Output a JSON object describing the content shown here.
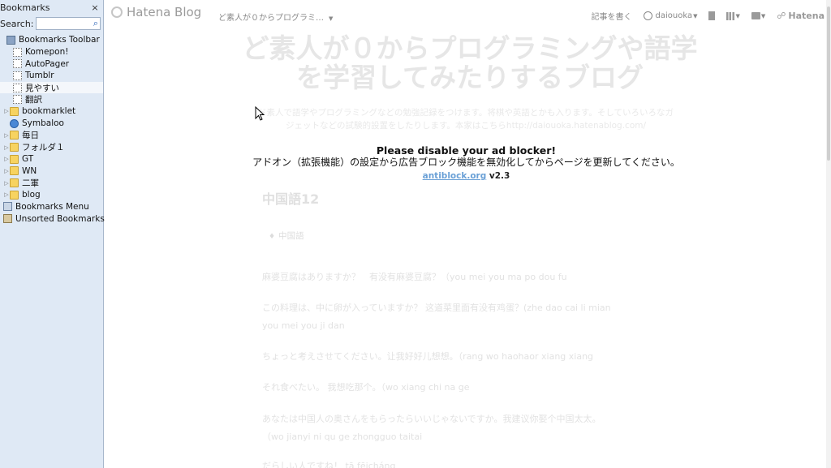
{
  "sidebar": {
    "title": "Bookmarks",
    "close": "×",
    "search_label": "Search:",
    "items": [
      {
        "label": "Bookmarks Toolbar",
        "icon": "toolbar-icon"
      },
      {
        "label": "Komepon!",
        "icon": "page-icon"
      },
      {
        "label": "AutoPager",
        "icon": "page-icon"
      },
      {
        "label": "Tumblr",
        "icon": "page-icon"
      },
      {
        "label": "見やすい",
        "icon": "page-icon"
      },
      {
        "label": "翻訳",
        "icon": "page-icon"
      },
      {
        "label": "bookmarklet",
        "icon": "folder-icon"
      },
      {
        "label": "Symbaloo",
        "icon": "globe-icon"
      },
      {
        "label": "毎日",
        "icon": "folder-icon"
      },
      {
        "label": "フォルダ１",
        "icon": "folder-icon"
      },
      {
        "label": "GT",
        "icon": "folder-icon"
      },
      {
        "label": "WN",
        "icon": "folder-icon"
      },
      {
        "label": "二軍",
        "icon": "folder-icon"
      },
      {
        "label": "blog",
        "icon": "folder-icon"
      },
      {
        "label": "Bookmarks Menu",
        "icon": "menu-icon"
      },
      {
        "label": "Unsorted Bookmarks",
        "icon": "unsorted-icon"
      }
    ]
  },
  "topbar": {
    "logo": "Hatena Blog",
    "breadcrumb": "ど素人が０からプログラミ…",
    "write": "記事を書く",
    "user": "daiouoka",
    "hatena": "Hatena"
  },
  "blog": {
    "title_line1": "ど素人が０からプログラミングや語学",
    "title_line2": "を学習してみたりするブログ",
    "desc_line1": "ド素人で語学やプログラミングなどの勉強記録をつけます。将棋や英語とかも入ります。そしていろいろなガ",
    "desc_line2": "ジェットなどの試験的設置をしたりします。本家はこちらhttp://daiouoka.hatenablog.com/"
  },
  "overlay": {
    "heading": "Please disable your ad blocker!",
    "message": "アドオン（拡張機能）の設定から広告ブロック機能を無効化してからページを更新してください。",
    "link": "antiblock.org",
    "version": "v2.3"
  },
  "post": {
    "title": "中国語12",
    "tag": "中国語",
    "paragraphs": [
      "麻婆豆腐はありますか？　有没有麻婆豆腐？（you mei you ma po dou fu",
      "この料理は、中に卵が入っていますか？ 这道菜里面有没有鸡蛋？(zhe dao cai li mian",
      "you mei you ji dan",
      "ちょっと考えさせてください。让我好好儿想想。（rang wo haohaor xiang xiang",
      "それ食べたい。 我想吃那个。（wo xiang chi na ge",
      "あなたは中国人の奥さんをもらったらいいじゃないですか。我建议你娶个中国太太。",
      "（wo jianyi ni qu ge zhongguo taitai",
      "だらしい人ですね！ tā fēicháng"
    ]
  }
}
